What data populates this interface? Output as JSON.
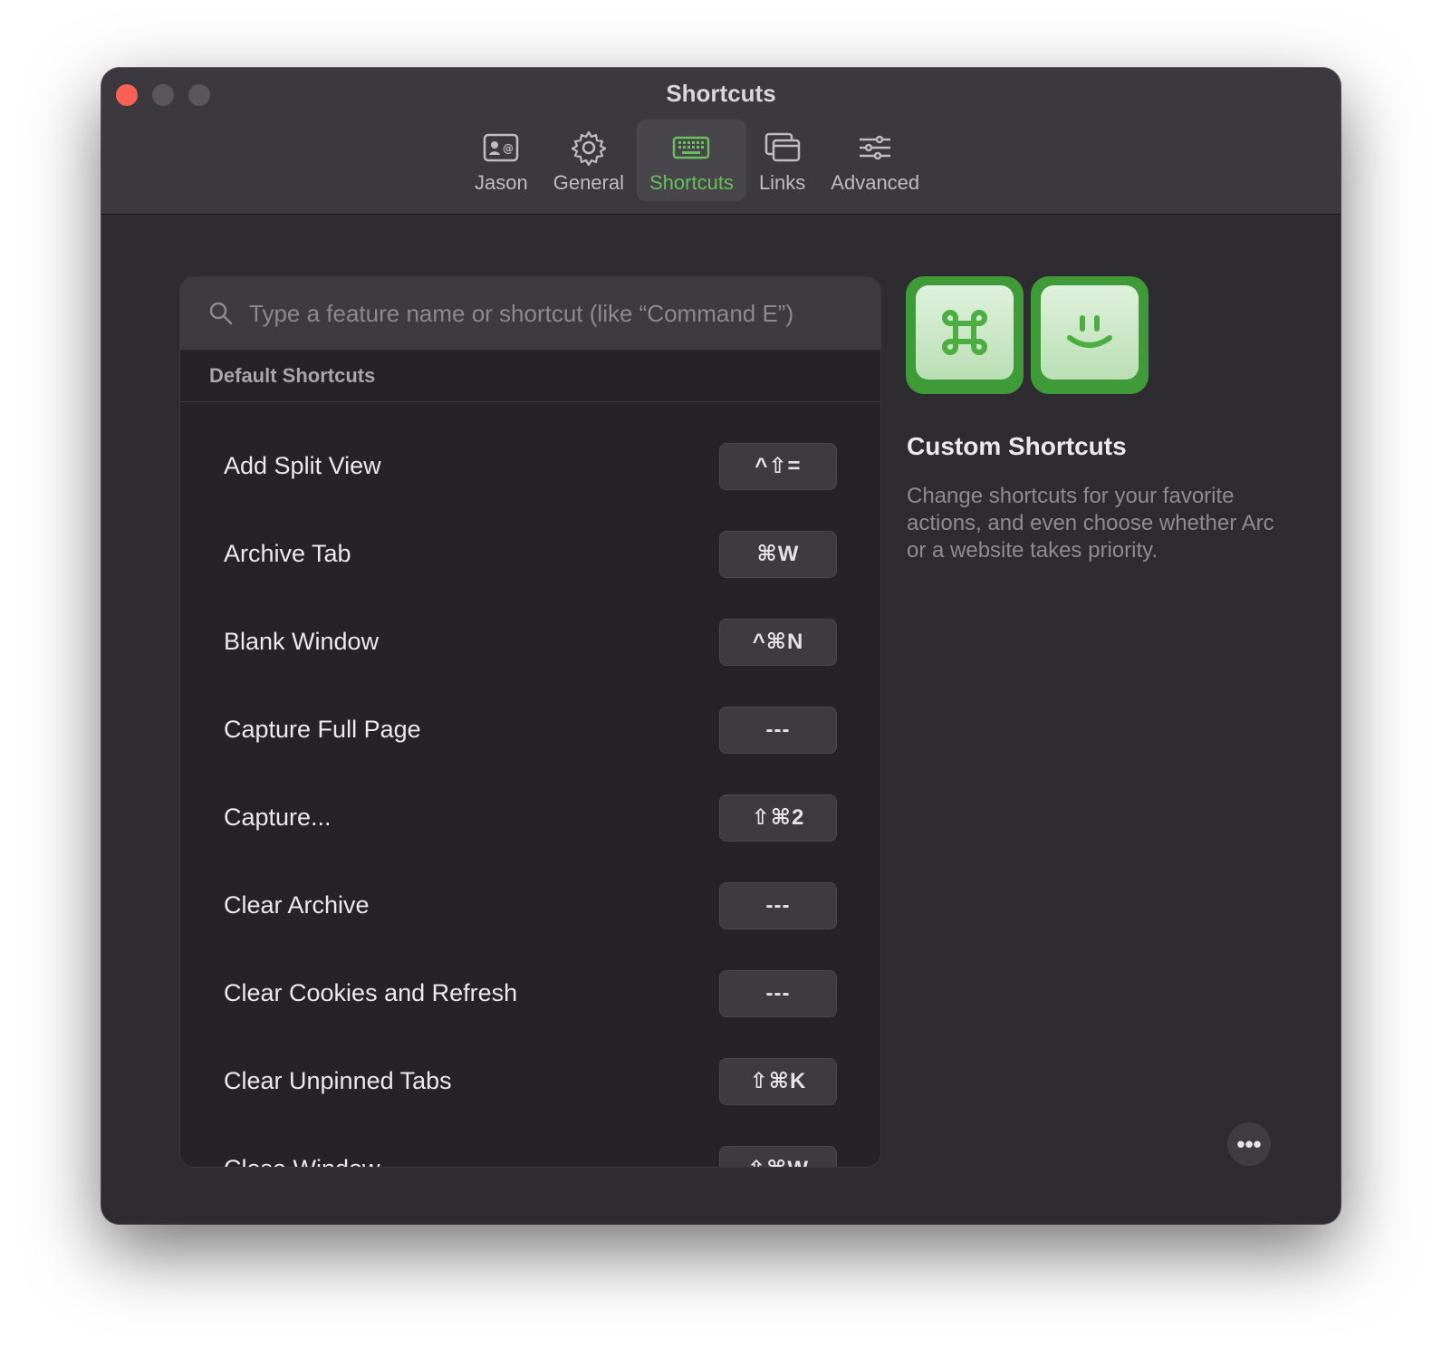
{
  "window": {
    "title": "Shortcuts"
  },
  "tabs": [
    {
      "label": "Jason",
      "icon": "contact-card-icon"
    },
    {
      "label": "General",
      "icon": "gear-icon"
    },
    {
      "label": "Shortcuts",
      "icon": "keyboard-icon",
      "active": true
    },
    {
      "label": "Links",
      "icon": "windows-icon"
    },
    {
      "label": "Advanced",
      "icon": "sliders-icon"
    }
  ],
  "search": {
    "placeholder": "Type a feature name or shortcut (like “Command E”)",
    "value": ""
  },
  "list": {
    "section_header": "Default Shortcuts",
    "rows": [
      {
        "label": "Add Split View",
        "keys": "^⇧="
      },
      {
        "label": "Archive Tab",
        "keys": "⌘W"
      },
      {
        "label": "Blank Window",
        "keys": "^⌘N"
      },
      {
        "label": "Capture Full Page",
        "keys": "---"
      },
      {
        "label": "Capture...",
        "keys": "⇧⌘2"
      },
      {
        "label": "Clear Archive",
        "keys": "---"
      },
      {
        "label": "Clear Cookies and Refresh",
        "keys": "---"
      },
      {
        "label": "Clear Unpinned Tabs",
        "keys": "⇧⌘K"
      },
      {
        "label": "Close Window",
        "keys": "⇧⌘W"
      }
    ]
  },
  "side": {
    "title": "Custom Shortcuts",
    "description": "Change shortcuts for your favorite actions, and even choose whether Arc or a website takes priority.",
    "more_label": "•••"
  },
  "colors": {
    "accent": "#66c15b",
    "close": "#fe5f57",
    "window_bg": "#2e2b31"
  }
}
